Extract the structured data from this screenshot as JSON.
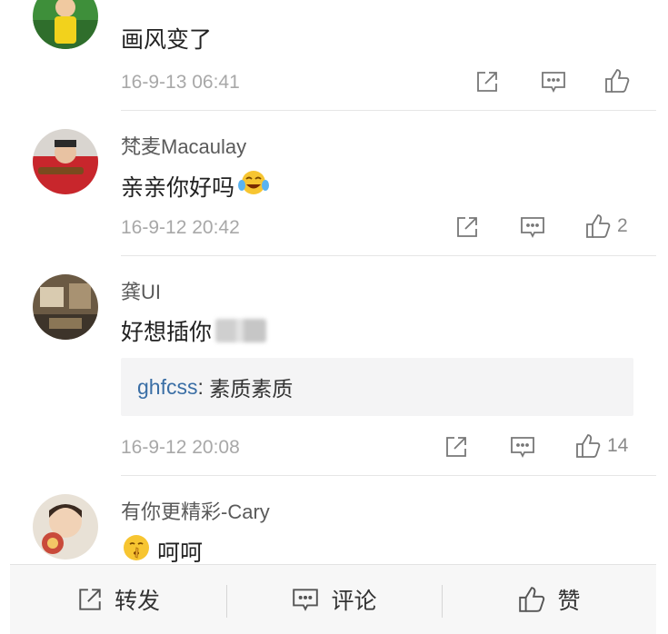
{
  "comments": [
    {
      "name": "",
      "text": "画风变了",
      "time": "16-9-13 06:41",
      "likes": ""
    },
    {
      "name": "梵麦Macaulay",
      "text": "亲亲你好吗",
      "time": "16-9-12 20:42",
      "likes": "2"
    },
    {
      "name": "龚UI",
      "text": "好想插你",
      "time": "16-9-12 20:08",
      "likes": "14",
      "reply": {
        "user": "ghfcss",
        "sep": ": ",
        "text": "素质素质"
      }
    },
    {
      "name": "有你更精彩-Cary",
      "text": "呵呵",
      "time": "",
      "likes": ""
    }
  ],
  "bottom_bar": {
    "repost_label": "转发",
    "comment_label": "评论",
    "like_label": "赞"
  },
  "colors": {
    "link": "#3a6ea5",
    "meta": "#a8a8a8",
    "divider": "#e6e6e6",
    "bar_bg": "#f7f7f7"
  },
  "icons": [
    "repost-icon",
    "comment-icon",
    "like-icon",
    "laugh-cry-emoji",
    "hush-emoji"
  ]
}
